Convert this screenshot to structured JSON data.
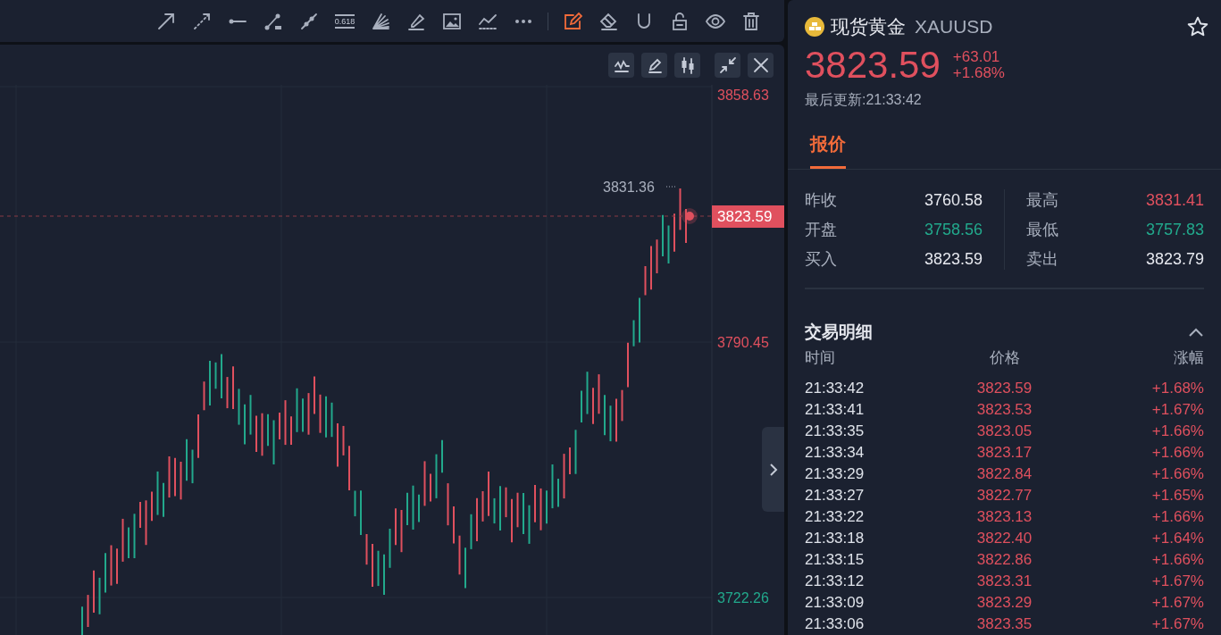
{
  "drawing_toolbar": [
    {
      "kind": "arrow",
      "selected": false
    },
    {
      "kind": "dashed-arrow",
      "selected": false
    },
    {
      "kind": "segment",
      "selected": false
    },
    {
      "kind": "ray",
      "selected": false
    },
    {
      "kind": "polyline",
      "selected": false
    },
    {
      "kind": "fib",
      "label": "0.618",
      "selected": false
    },
    {
      "kind": "fan",
      "selected": false
    },
    {
      "kind": "highlighter",
      "selected": false
    },
    {
      "kind": "image",
      "selected": false
    },
    {
      "kind": "trend",
      "selected": false
    },
    {
      "kind": "more",
      "selected": false
    },
    {
      "kind": "edit",
      "selected": true
    },
    {
      "kind": "eraser",
      "selected": false
    },
    {
      "kind": "magnet",
      "selected": false
    },
    {
      "kind": "lock",
      "selected": false
    },
    {
      "kind": "eye",
      "selected": false
    },
    {
      "kind": "trash",
      "selected": false
    }
  ],
  "chart": {
    "buttons": [
      {
        "kind": "indicator"
      },
      {
        "kind": "brush"
      },
      {
        "kind": "candles"
      },
      {
        "kind": "shrink"
      },
      {
        "kind": "close"
      }
    ],
    "price_axis": [
      {
        "label": "3858.63",
        "color": "#e0505e"
      },
      {
        "label": "3790.45",
        "color": "#e0505e"
      },
      {
        "label": "3722.26",
        "color": "#22a98c"
      }
    ],
    "high_marker": "3831.36",
    "current_price_label": "3823.59"
  },
  "quote": {
    "name": "现货黄金",
    "symbol": "XAUUSD",
    "favorite": false,
    "price": "3823.59",
    "change": "+63.01",
    "change_percent": "+1.68%",
    "updated": "最后更新:21:33:42"
  },
  "tabs": [
    {
      "label": "报价",
      "selected": true
    }
  ],
  "stats": [
    [
      {
        "label": "昨收",
        "value": "3760.58",
        "color": "#e6e8ee"
      },
      {
        "label": "最高",
        "value": "3831.41",
        "color": "#e0505e"
      }
    ],
    [
      {
        "label": "开盘",
        "value": "3758.56",
        "color": "#22a98c"
      },
      {
        "label": "最低",
        "value": "3757.83",
        "color": "#22a98c"
      }
    ],
    [
      {
        "label": "买入",
        "value": "3823.59",
        "color": "#e6e8ee"
      },
      {
        "label": "卖出",
        "value": "3823.79",
        "color": "#e6e8ee"
      }
    ]
  ],
  "trades": {
    "title": "交易明细",
    "expanded": true,
    "columns": [
      "时间",
      "价格",
      "涨幅"
    ],
    "rows": [
      [
        "21:33:42",
        "3823.59",
        "+1.68%"
      ],
      [
        "21:33:41",
        "3823.53",
        "+1.67%"
      ],
      [
        "21:33:35",
        "3823.05",
        "+1.66%"
      ],
      [
        "21:33:34",
        "3823.17",
        "+1.66%"
      ],
      [
        "21:33:29",
        "3822.84",
        "+1.66%"
      ],
      [
        "21:33:27",
        "3822.77",
        "+1.65%"
      ],
      [
        "21:33:22",
        "3823.13",
        "+1.66%"
      ],
      [
        "21:33:18",
        "3822.40",
        "+1.64%"
      ],
      [
        "21:33:15",
        "3822.86",
        "+1.66%"
      ],
      [
        "21:33:12",
        "3823.31",
        "+1.67%"
      ],
      [
        "21:33:09",
        "3823.29",
        "+1.67%"
      ],
      [
        "21:33:06",
        "3823.35",
        "+1.67%"
      ]
    ]
  }
}
